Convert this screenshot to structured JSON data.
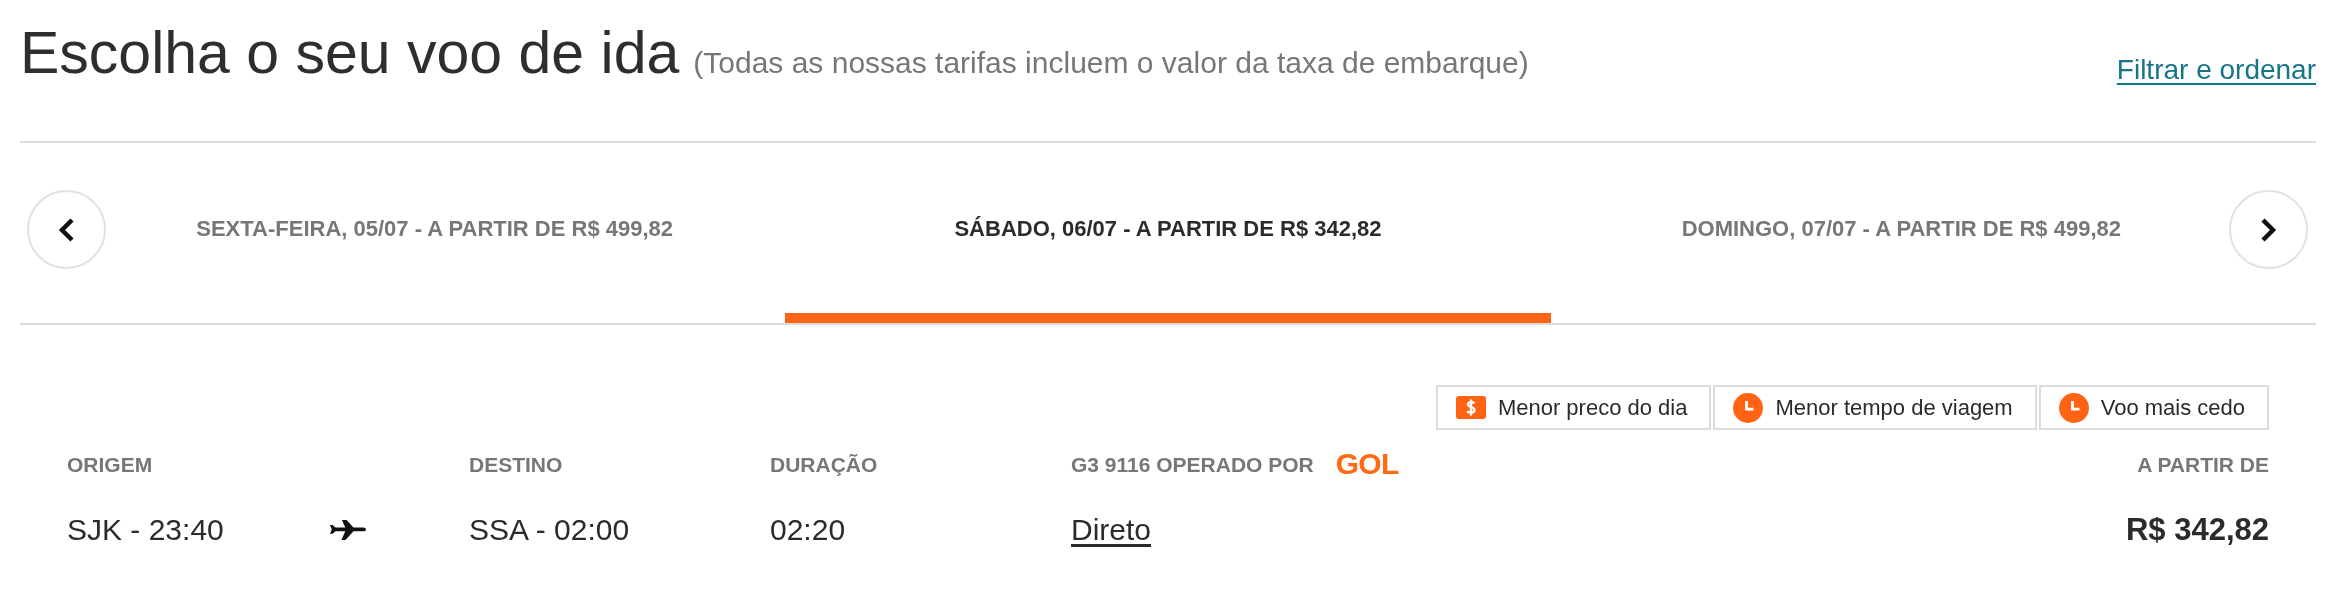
{
  "header": {
    "title": "Escolha o seu voo de ida",
    "subtitle": "(Todas as nossas tarifas incluem o valor da taxa de embarque)",
    "link": "Filtrar e ordenar"
  },
  "date_tabs": [
    {
      "label": "SEXTA-FEIRA, 05/07 - A PARTIR DE R$ 499,82",
      "selected": false
    },
    {
      "label": "SÁBADO, 06/07 - A PARTIR DE R$ 342,82",
      "selected": true
    },
    {
      "label": "DOMINGO, 07/07 - A PARTIR DE R$ 499,82",
      "selected": false
    }
  ],
  "badges": [
    {
      "kind": "price",
      "label": "Menor preco do dia"
    },
    {
      "kind": "time",
      "label": "Menor tempo de viagem"
    },
    {
      "kind": "time",
      "label": "Voo mais cedo"
    }
  ],
  "flight": {
    "origin": {
      "heading": "ORIGEM",
      "value": "SJK - 23:40"
    },
    "destination": {
      "heading": "DESTINO",
      "value": "SSA - 02:00"
    },
    "duration": {
      "heading": "DURAÇÃO",
      "value": "02:20"
    },
    "operator": {
      "heading": "G3 9116 OPERADO POR",
      "logo": "GOL",
      "stops": "Direto"
    },
    "price": {
      "heading": "A PARTIR DE",
      "value": "R$ 342,82"
    }
  }
}
